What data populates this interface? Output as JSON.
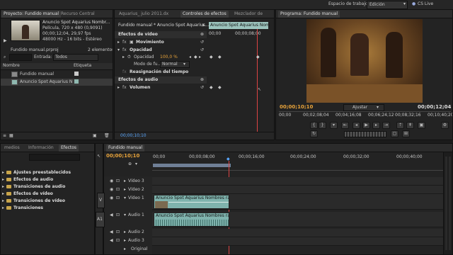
{
  "topbar": {
    "workspace_label": "Espacio de trabajo:",
    "workspace_value": "Edición",
    "cs_live": "CS Live"
  },
  "project": {
    "tabs": [
      "Proyecto: Fundido manual",
      "Recurso Central"
    ],
    "clip_name": "Anuncio Spot Aquarius Nombr...",
    "clip_info1": "Película, 720 x 480 (0,9091)",
    "clip_info2": "00;00;12;04, 29,97 fps",
    "clip_info3": "48000 Hz - 16 bits - Estéreo",
    "file_name": "Fundido manual.prproj",
    "item_count": "2 elementos",
    "entrada_label": "Entrada:",
    "entrada_value": "Todos",
    "col_name": "Nombre",
    "col_label": "Etiqueta",
    "items": [
      {
        "name": "Fundido manual",
        "color": "#c9c9c9"
      },
      {
        "name": "Anuncio Spot Aquarius N",
        "color": "#8fb8b0"
      }
    ]
  },
  "effect_controls": {
    "tabs": [
      "Aquarius_ julio 2011.dx",
      "Controles de efectos",
      "Mezclador de"
    ],
    "header": "Fundido manual * Anuncio Spot Aquarius...",
    "clip_label": "Anuncio Spot Aquarius Nom",
    "ruler": [
      "00;00",
      "00;00;08;00"
    ],
    "video_effects": "Efectos de vídeo",
    "movimiento": "Movimiento",
    "opacidad": "Opacidad",
    "opacidad_prop": "Opacidad",
    "opacidad_value": "100,0 %",
    "modo_label": "Modo de fu...",
    "modo_value": "Normal",
    "reasignacion": "Reasignación del tiempo",
    "audio_effects": "Efectos de audio",
    "volumen": "Volumen",
    "timecode": "00;00;10;10"
  },
  "program": {
    "title": "Programa: Fundido manual",
    "current_time": "00;00;10;10",
    "duration": "00;00;12;04",
    "fit": "Ajustar",
    "ruler": [
      "00;00",
      "00;02;08;04",
      "00;04;16;08",
      "00;06;24;12",
      "00;08;32;16",
      "00;10;40;20"
    ]
  },
  "effects_panel": {
    "tabs": [
      "medios",
      "Información",
      "Efectos"
    ],
    "folders": [
      "Ajustes preestablecidos",
      "Efectos de audio",
      "Transiciones de audio",
      "Efectos de vídeo",
      "Transiciones de vídeo",
      "Transiciones"
    ]
  },
  "timeline": {
    "title": "Fundido manual",
    "timecode": "00;00;10;10",
    "ruler": [
      "00;00",
      "00;00;08;00",
      "00;00;16;00",
      "00;00;24;00",
      "00;00;32;00",
      "00;00;40;00"
    ],
    "tracks": [
      "Vídeo 3",
      "Vídeo 2",
      "Vídeo 1",
      "Audio 1",
      "Audio 2",
      "Audio 3",
      "Original"
    ],
    "video_clip_label": "Anuncio Spot Aquarius Nombres raros",
    "audio_clip_label": "Anuncio Spot Aquarius Nombres raros",
    "v_marker": "V",
    "a_marker": "A1"
  },
  "colors": {
    "accent_orange": "#e8a33a",
    "accent_blue": "#5aa8ff",
    "video_clip": "#7fb3ad",
    "audio_clip": "#7fb3ad",
    "playhead": "#d44"
  }
}
